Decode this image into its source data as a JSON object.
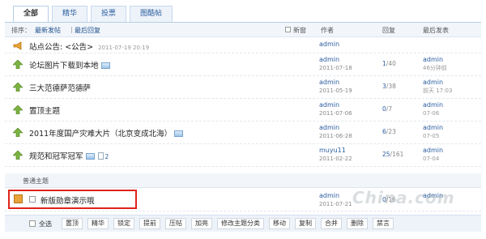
{
  "tabs": [
    {
      "label": "全部",
      "active": true
    },
    {
      "label": "精华",
      "active": false
    },
    {
      "label": "投票",
      "active": false
    },
    {
      "label": "图酷帖",
      "active": false
    }
  ],
  "header": {
    "sort_label": "排序：",
    "sort_newest": "最新发帖",
    "separator": "|",
    "sort_last_reply": "最后回复",
    "new_window": "新窗",
    "col_author": "作者",
    "col_reply": "回复",
    "col_last_post": "最后发表"
  },
  "announcement": {
    "title": "站点公告: <公告>",
    "date": "2011-07-19 20:19",
    "author": "admin"
  },
  "threads": [
    {
      "title": "论坛图片下载到本地",
      "has_image": true,
      "author": "admin",
      "date": "2011-07-18",
      "replies": "1",
      "views": "40",
      "last_by": "admin",
      "last_time": "46分钟前"
    },
    {
      "title": "三大范德萨范德萨",
      "has_image": false,
      "author": "admin",
      "date": "2011-05-19",
      "replies": "3",
      "views": "38",
      "last_by": "admin",
      "last_time": "前天 17:03"
    },
    {
      "title": "置顶主题",
      "has_image": false,
      "author": "admin",
      "date": "2011-07-06",
      "replies": "0",
      "views": "7",
      "last_by": "admin",
      "last_time": "07-06"
    },
    {
      "title": "2011年度国产灾难大片（北京变成北海）",
      "has_image": true,
      "author": "admin",
      "date": "2011-06-28",
      "replies": "6",
      "views": "23",
      "last_by": "admin",
      "last_time": "07-05"
    },
    {
      "title": "规范和冠军冠军",
      "has_image": true,
      "pages": "2",
      "author": "muyu11",
      "date": "2011-02-22",
      "replies": "25",
      "views": "161",
      "last_by": "admin",
      "last_time": "07-04"
    }
  ],
  "group_label": "普通主题",
  "highlighted_thread": {
    "title": "新版勋章演示哦",
    "author": "admin",
    "date": "2011-07-21",
    "replies": "0",
    "views": "16",
    "last_by": "admin"
  },
  "toolbar": {
    "select_all": "全选",
    "buttons": [
      "置顶",
      "精华",
      "锁定",
      "提前",
      "压帖",
      "加亮",
      "修改主题分类",
      "移动",
      "复制",
      "合并",
      "删除",
      "禁言"
    ]
  },
  "watermark": "China.com",
  "colors": {
    "highlight_border": "#e0231c",
    "link": "#2a5d9f",
    "header_bg": "#f2f6fb"
  }
}
